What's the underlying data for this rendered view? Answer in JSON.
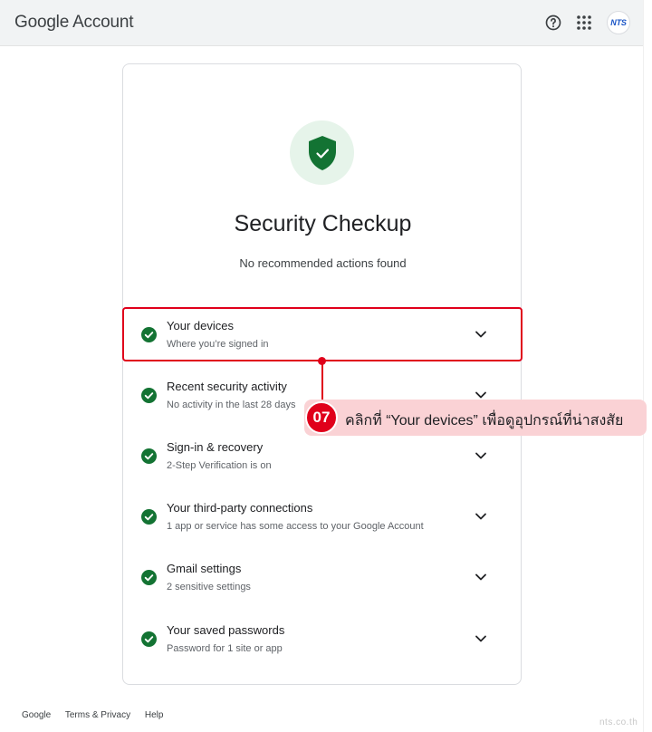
{
  "header": {
    "brand_google": "Google",
    "brand_account": "Account",
    "avatar_text": "NTS",
    "icons": [
      "help-icon",
      "apps-grid-icon"
    ]
  },
  "checkup": {
    "title": "Security Checkup",
    "subtitle": "No recommended actions found",
    "items": [
      {
        "title": "Your devices",
        "subtitle": "Where you’re signed in"
      },
      {
        "title": "Recent security activity",
        "subtitle": "No activity in the last 28 days"
      },
      {
        "title": "Sign-in & recovery",
        "subtitle": "2-Step Verification is on"
      },
      {
        "title": "Your third-party connections",
        "subtitle": "1 app or service has some access to your Google Account"
      },
      {
        "title": "Gmail settings",
        "subtitle": "2 sensitive settings"
      },
      {
        "title": "Your saved passwords",
        "subtitle": "Password for 1 site or app"
      }
    ]
  },
  "callout": {
    "number": "07",
    "text": "คลิกที่ “Your devices” เพื่อดูอุปกรณ์ที่น่าสงสัย"
  },
  "footer": {
    "links": [
      "Google",
      "Terms & Privacy",
      "Help"
    ]
  },
  "watermark": "nts.co.th",
  "colors": {
    "accent_green": "#137333",
    "shield_bg": "#e6f4ea",
    "annotation_red": "#e0001b",
    "callout_bg": "#fad2d5"
  }
}
